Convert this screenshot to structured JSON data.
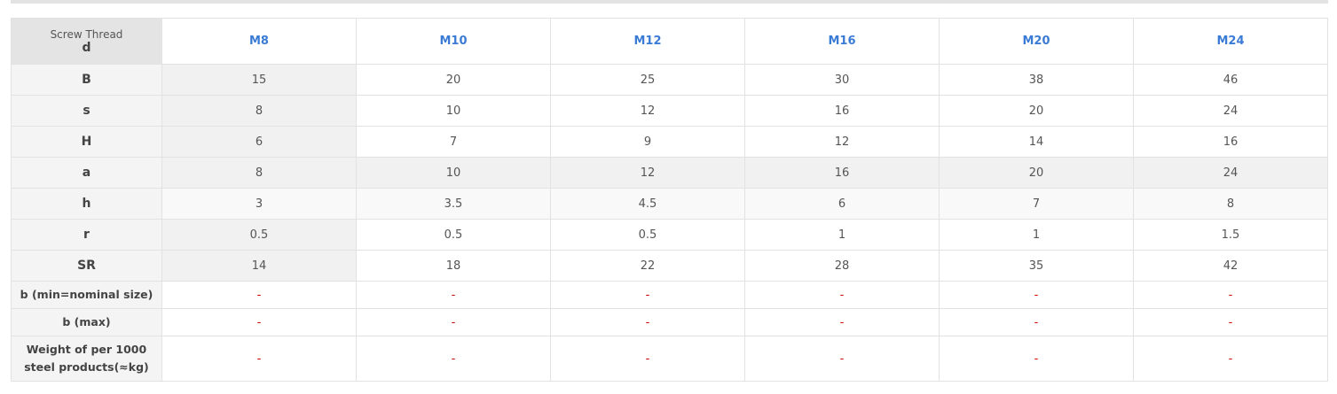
{
  "table": {
    "corner_label": "Screw Thread",
    "corner_symbol": "d",
    "sizes": [
      "M8",
      "M10",
      "M12",
      "M16",
      "M20",
      "M24"
    ],
    "rows": [
      {
        "label": "B",
        "values": [
          "15",
          "20",
          "25",
          "30",
          "38",
          "46"
        ]
      },
      {
        "label": "s",
        "values": [
          "8",
          "10",
          "12",
          "16",
          "20",
          "24"
        ]
      },
      {
        "label": "H",
        "values": [
          "6",
          "7",
          "9",
          "12",
          "14",
          "16"
        ]
      },
      {
        "label": "a",
        "values": [
          "8",
          "10",
          "12",
          "16",
          "20",
          "24"
        ]
      },
      {
        "label": "h",
        "values": [
          "3",
          "3.5",
          "4.5",
          "6",
          "7",
          "8"
        ]
      },
      {
        "label": "r",
        "values": [
          "0.5",
          "0.5",
          "0.5",
          "1",
          "1",
          "1.5"
        ]
      },
      {
        "label": "SR",
        "values": [
          "14",
          "18",
          "22",
          "28",
          "35",
          "42"
        ]
      },
      {
        "label": "b (min=nominal size)",
        "values": [
          "-",
          "-",
          "-",
          "-",
          "-",
          "-"
        ]
      },
      {
        "label": "b (max)",
        "values": [
          "-",
          "-",
          "-",
          "-",
          "-",
          "-"
        ]
      },
      {
        "label": "Weight of per 1000 steel products(≈kg)",
        "values": [
          "-",
          "-",
          "-",
          "-",
          "-",
          "-"
        ]
      }
    ]
  }
}
